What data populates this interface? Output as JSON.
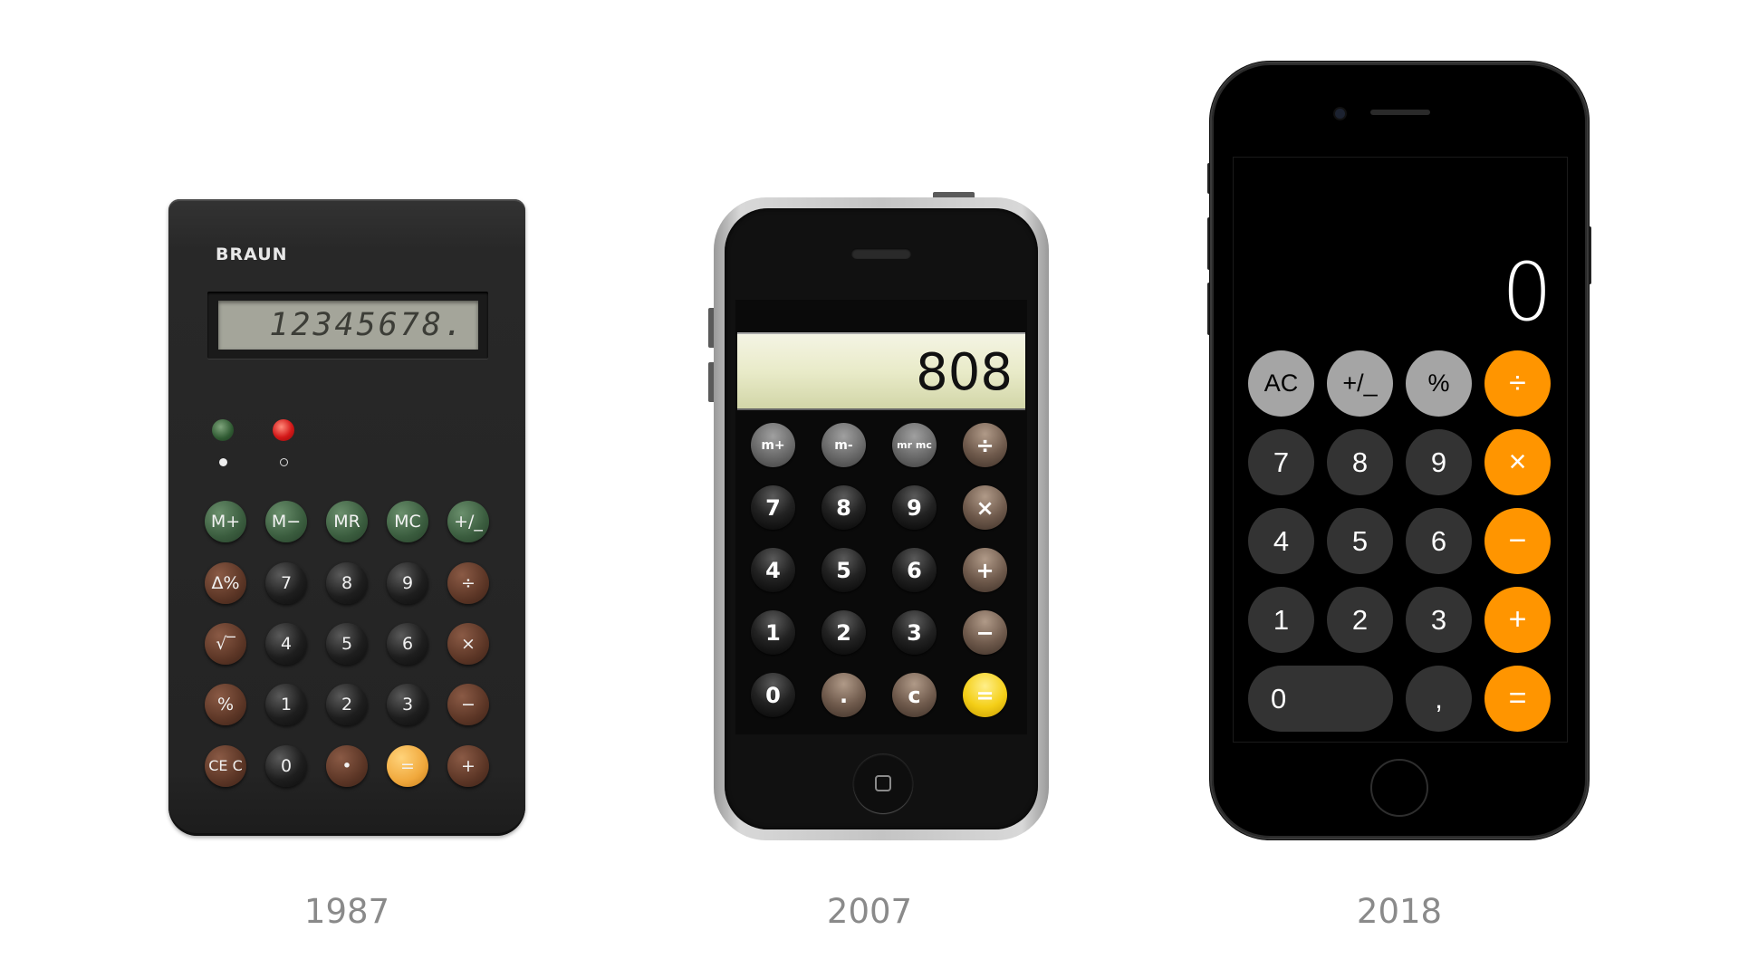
{
  "captions": {
    "braun": "1987",
    "iphone2007": "2007",
    "iphone2018": "2018"
  },
  "braun": {
    "brand": "BRAUN",
    "display": "12345678.",
    "rows": [
      [
        "M+",
        "M−",
        "MR",
        "MC",
        "+/_"
      ],
      [
        "Δ%",
        "7",
        "8",
        "9",
        "÷"
      ],
      [
        "√‾",
        "4",
        "5",
        "6",
        "×"
      ],
      [
        "%",
        "1",
        "2",
        "3",
        "−"
      ],
      [
        "CE C",
        "0",
        "•",
        "=",
        "+"
      ]
    ]
  },
  "iphone2007": {
    "display": "808",
    "rows": [
      [
        "m+",
        "m-",
        "mr mc",
        "÷"
      ],
      [
        "7",
        "8",
        "9",
        "×"
      ],
      [
        "4",
        "5",
        "6",
        "+"
      ],
      [
        "1",
        "2",
        "3",
        "−"
      ],
      [
        "0",
        ".",
        "c",
        "="
      ]
    ]
  },
  "iphone2018": {
    "display": "0",
    "rows": [
      [
        "AC",
        "+/_",
        "%",
        "÷"
      ],
      [
        "7",
        "8",
        "9",
        "×"
      ],
      [
        "4",
        "5",
        "6",
        "−"
      ],
      [
        "1",
        "2",
        "3",
        "+"
      ],
      [
        "0",
        ",",
        "="
      ]
    ]
  },
  "colors": {
    "ios_orange": "#ff9500",
    "ios_light_gray": "#a5a5a5",
    "ios_dark_gray": "#333333",
    "braun_green": "#3a5c3e",
    "braun_brown": "#5c3626",
    "braun_yellow": "#f0a83c"
  }
}
